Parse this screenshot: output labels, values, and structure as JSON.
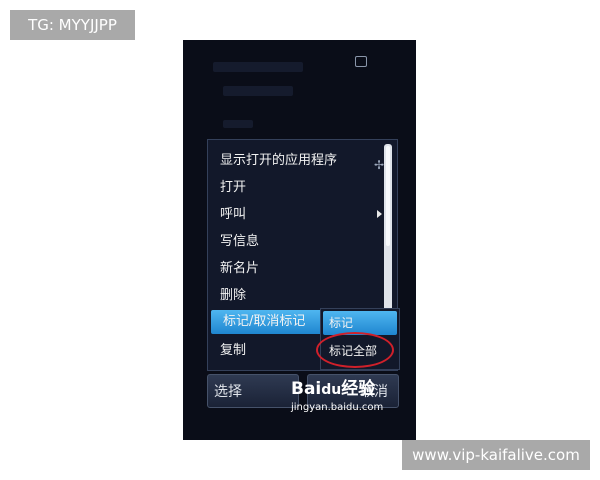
{
  "tag_label": "TG: MYYJJPP",
  "url_label": "www.vip-kaifalive.com",
  "menu": {
    "items": [
      {
        "label": "显示打开的应用程序"
      },
      {
        "label": "打开"
      },
      {
        "label": "呼叫"
      },
      {
        "label": "写信息"
      },
      {
        "label": "新名片"
      },
      {
        "label": "删除"
      },
      {
        "label": "标记/取消标记"
      },
      {
        "label": "复制"
      }
    ]
  },
  "submenu": {
    "items": [
      {
        "label": "标记"
      },
      {
        "label": "标记全部"
      }
    ]
  },
  "softkeys": {
    "left": "选择",
    "right": "取消"
  },
  "watermark": {
    "brand_left": "Bai",
    "brand_paw": "du",
    "brand_right": "经验",
    "sub": "jingyan.baidu.com"
  },
  "colors": {
    "selection": "#1f86d0",
    "annotation": "#d0202a",
    "screen_bg": "#0a0d18"
  }
}
